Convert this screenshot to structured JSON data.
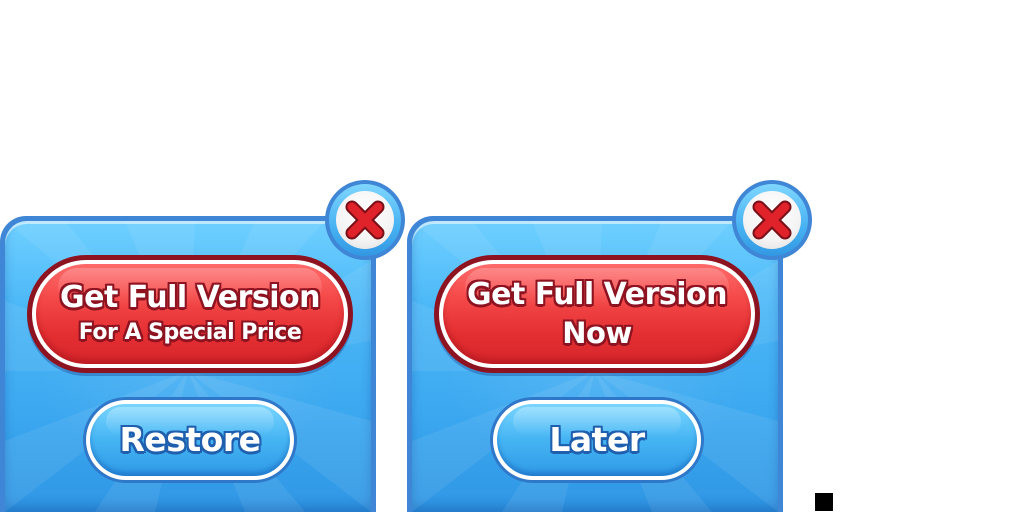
{
  "dialogs": [
    {
      "cta": {
        "line1": "Get Full Version",
        "line2": "For A Special Price"
      },
      "secondary_label": "Restore",
      "close_icon": "close-x-icon"
    },
    {
      "cta": {
        "line1": "Get Full Version",
        "line2": "Now"
      },
      "secondary_label": "Later",
      "close_icon": "close-x-icon"
    }
  ],
  "colors": {
    "panel_blue": "#4bb7f7",
    "panel_border": "#3f86d6",
    "cta_red": "#f44848",
    "cta_border": "#8e1321",
    "close_x_red": "#e0222a",
    "text_white": "#ffffff"
  }
}
